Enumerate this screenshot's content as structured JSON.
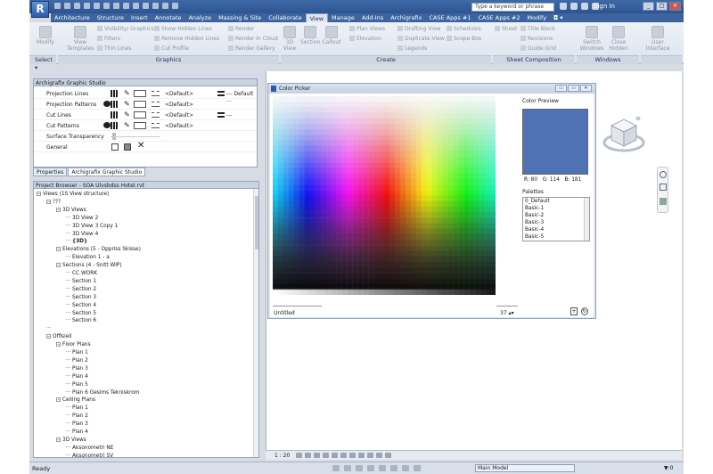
{
  "app": {
    "logo": "R",
    "search_placeholder": "Type a keyword or phrase",
    "sign_in": "Sign In",
    "win_buttons": [
      "_",
      "□",
      "✕"
    ]
  },
  "tabs": [
    "Architecture",
    "Structure",
    "Insert",
    "Annotate",
    "Analyze",
    "Massing & Site",
    "Collaborate",
    "View",
    "Manage",
    "Add-Ins",
    "Archigrafix",
    "CASE Apps #1",
    "CASE Apps #2",
    "Modify",
    "◘ ▾"
  ],
  "active_tab": "View",
  "ribbon": {
    "modify": "Modify",
    "view_templates": "View Templates",
    "visibility": "Visibility/ Graphics",
    "filters": "Filters",
    "thin_lines": "Thin Lines",
    "show_hidden": "Show Hidden Lines",
    "remove_hidden": "Remove Hidden Lines",
    "cut_profile": "Cut Profile",
    "render": "Render",
    "render_cloud": "Render in Cloud",
    "render_gallery": "Render Gallery",
    "view_3d": "3D View",
    "section": "Section",
    "callout": "Callout",
    "plan_views": "Plan Views",
    "elevation": "Elevation",
    "drafting_view": "Drafting View",
    "duplicate_view": "Duplicate View",
    "legends": "Legends",
    "schedules": "Schedules",
    "scope_box": "Scope Box",
    "sheet": "Sheet",
    "title_block": "Title Block",
    "revisions": "Revisions",
    "guide_grid": "Guide Grid",
    "switch_windows": "Switch Windows",
    "close_hidden": "Close Hidden",
    "user_interface": "User Interface",
    "select": "Select ▾",
    "graphics": "Graphics",
    "create": "Create",
    "sheet_composition": "Sheet Composition",
    "windows": "Windows"
  },
  "properties_palette": {
    "title": "Archigrafix Graphic Studio",
    "rows": [
      {
        "label": "Projection Lines",
        "value": "<Default>",
        "value2": "--- Default ..."
      },
      {
        "label": "Projection Patterns",
        "value": "<Default>"
      },
      {
        "label": "Cut Lines",
        "value": "<Default>",
        "value2": "---"
      },
      {
        "label": "Cut Patterns",
        "value": "<Default>"
      },
      {
        "label": "Surface Transparency"
      },
      {
        "label": "General"
      }
    ],
    "tabs": [
      "Properties",
      "Archigrafix Graphic Studio"
    ]
  },
  "project_browser": {
    "title": "Project Browser - SOA Ulvsbdss Hotel.rvt",
    "items": [
      {
        "text": "Views (1S View structure)",
        "level": 0,
        "toggle": "−"
      },
      {
        "text": "???",
        "level": 1,
        "toggle": "−"
      },
      {
        "text": "3D Views",
        "level": 2,
        "toggle": "−"
      },
      {
        "text": "3D View 2",
        "level": 3
      },
      {
        "text": "3D View 3 Copy 1",
        "level": 3
      },
      {
        "text": "3D View 4",
        "level": 3
      },
      {
        "text": "{3D}",
        "level": 3,
        "bold": true
      },
      {
        "text": "Elevations (5 - Oppriss Skisse)",
        "level": 2,
        "toggle": "−"
      },
      {
        "text": "Elevation 1 - a",
        "level": 3
      },
      {
        "text": "Sections (4 - Snitt WIP)",
        "level": 2,
        "toggle": "−"
      },
      {
        "text": "CC WORK",
        "level": 3
      },
      {
        "text": "Section 1",
        "level": 3
      },
      {
        "text": "Section 2",
        "level": 3
      },
      {
        "text": "Section 3",
        "level": 3
      },
      {
        "text": "Section 4",
        "level": 3
      },
      {
        "text": "Section 5",
        "level": 3
      },
      {
        "text": "Section 6",
        "level": 3
      },
      {
        "text": "",
        "level": 1
      },
      {
        "text": "Offisiell",
        "level": 1,
        "toggle": "−"
      },
      {
        "text": "Floor Plans",
        "level": 2,
        "toggle": "−"
      },
      {
        "text": "Plan 1",
        "level": 3
      },
      {
        "text": "Plan 2",
        "level": 3
      },
      {
        "text": "Plan 3",
        "level": 3
      },
      {
        "text": "Plan 4",
        "level": 3
      },
      {
        "text": "Plan 5",
        "level": 3
      },
      {
        "text": "Plan 6 Gesims Tekniskrom",
        "level": 3
      },
      {
        "text": "Ceiling Plans",
        "level": 2,
        "toggle": "−"
      },
      {
        "text": "Plan 1",
        "level": 3
      },
      {
        "text": "Plan 2",
        "level": 3
      },
      {
        "text": "Plan 3",
        "level": 3
      },
      {
        "text": "Plan 4",
        "level": 3
      },
      {
        "text": "3D Views",
        "level": 2,
        "toggle": "−"
      },
      {
        "text": "Aksonometri NE",
        "level": 3
      },
      {
        "text": "Aksonometri SV",
        "level": 3
      }
    ]
  },
  "color_picker": {
    "title": "Color Picker",
    "preview_label": "Color Preview",
    "preview_color": "#5072b5",
    "rgb": {
      "r": "R: 80",
      "g": "G: 114",
      "b": "B: 181"
    },
    "palettes_label": "Palettes",
    "palettes": [
      "0_Default",
      "Basic-1",
      "Basic-2",
      "Basic-3",
      "Basic-4",
      "Basic-5"
    ],
    "name": "Untitled",
    "count": "37 ▴▾",
    "dlg_buttons": [
      "▭",
      "▭",
      "✕"
    ]
  },
  "view_control": {
    "scale": "1 : 20"
  },
  "status": {
    "text": "Ready",
    "model": "Main Model",
    "filter": "▼:0"
  }
}
